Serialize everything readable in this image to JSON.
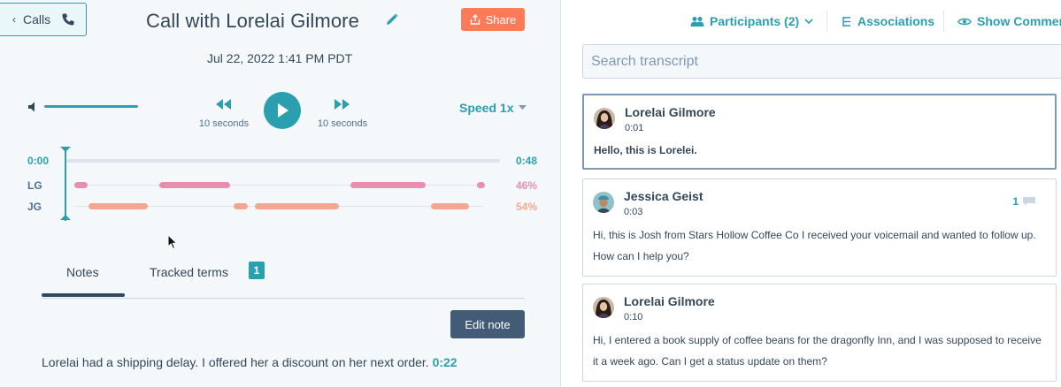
{
  "header": {
    "back_label": "Calls",
    "title": "Call with Lorelai Gilmore",
    "share_label": "Share",
    "date": "Jul 22, 2022 1:41 PM PDT"
  },
  "player": {
    "rewind_label": "10 seconds",
    "forward_label": "10 seconds",
    "speed_label": "Speed 1x",
    "volume_level": 1.0
  },
  "timeline": {
    "start": "0:00",
    "end": "0:48",
    "speakers": [
      {
        "initials": "LG",
        "percent": "46%",
        "color": "#e78fad"
      },
      {
        "initials": "JG",
        "percent": "54%",
        "color": "#f5a68f"
      }
    ]
  },
  "tabs": {
    "notes_label": "Notes",
    "terms_label": "Tracked terms",
    "terms_count": "1"
  },
  "notes": {
    "edit_label": "Edit note",
    "text": "Lorelai had a shipping delay. I offered her a discount on her next order.",
    "timestamp": "0:22"
  },
  "transcript": {
    "participants_label": "Participants (2)",
    "associations_label": "Associations",
    "comments_label": "Show Comments",
    "search_placeholder": "Search transcript",
    "entries": [
      {
        "speaker": "Lorelai Gilmore",
        "time": "0:01",
        "text": "Hello, this is Lorelei."
      },
      {
        "speaker": "Jessica Geist",
        "time": "0:03",
        "text": "Hi, this is Josh from Stars Hollow Coffee Co I received your voicemail and wanted to follow up. How can I help you?",
        "comments": "1"
      },
      {
        "speaker": "Lorelai Gilmore",
        "time": "0:10",
        "text": "Hi, I entered a book supply of coffee beans for the dragonfly Inn, and I was supposed to receive it a week ago. Can I get a status update on them?"
      }
    ]
  },
  "colors": {
    "accent": "#2a9fb0",
    "share": "#ff7a59",
    "dark_button": "#425b76"
  }
}
